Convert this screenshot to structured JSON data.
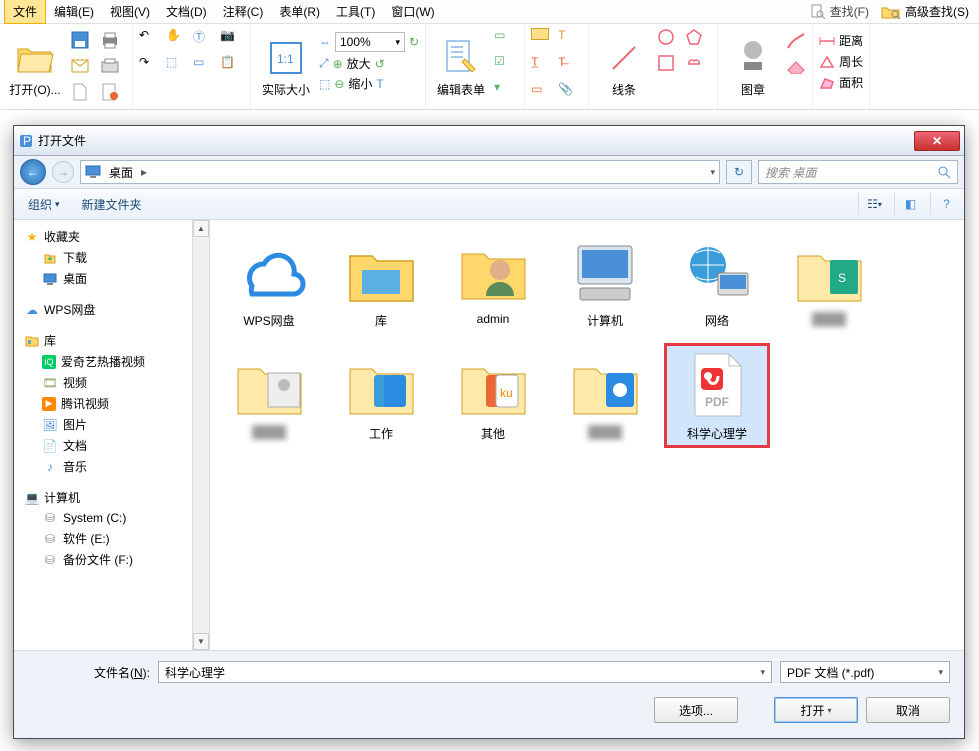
{
  "menu": {
    "items": [
      "文件",
      "编辑(E)",
      "视图(V)",
      "文档(D)",
      "注释(C)",
      "表单(R)",
      "工具(T)",
      "窗口(W)"
    ],
    "search": "查找(F)",
    "adv_search": "高级查找(S)"
  },
  "ribbon": {
    "open": "打开(O)...",
    "zoom_pct": "100%",
    "actual_size": "实际大小",
    "zoom_in": "放大",
    "zoom_out": "缩小",
    "edit_form": "编辑表单",
    "line": "线条",
    "image": "图章",
    "distance": "距离",
    "perimeter": "周长",
    "area": "面积"
  },
  "dialog": {
    "title": "打开文件",
    "breadcrumb_root": "桌面",
    "search_placeholder": "搜索 桌面",
    "toolbar": {
      "organize": "组织",
      "new_folder": "新建文件夹"
    },
    "sidebar": {
      "favorites": {
        "label": "收藏夹",
        "items": [
          "下载",
          "桌面"
        ]
      },
      "wps": "WPS网盘",
      "libraries": {
        "label": "库",
        "items": [
          "爱奇艺热播视频",
          "视频",
          "腾讯视频",
          "图片",
          "文档",
          "音乐"
        ]
      },
      "computer": {
        "label": "计算机",
        "items": [
          "System (C:)",
          "软件 (E:)",
          "备份文件 (F:)"
        ]
      }
    },
    "files": {
      "row1": [
        "WPS网盘",
        "库",
        "admin",
        "计算机",
        "网络",
        "████",
        "████"
      ],
      "row2": [
        "工作",
        "其他",
        "████",
        "科学心理学"
      ]
    },
    "filename_label": "文件名(N):",
    "filename_value": "科学心理学",
    "filter_value": "PDF 文档 (*.pdf)",
    "options": "选项...",
    "open": "打开",
    "cancel": "取消"
  }
}
